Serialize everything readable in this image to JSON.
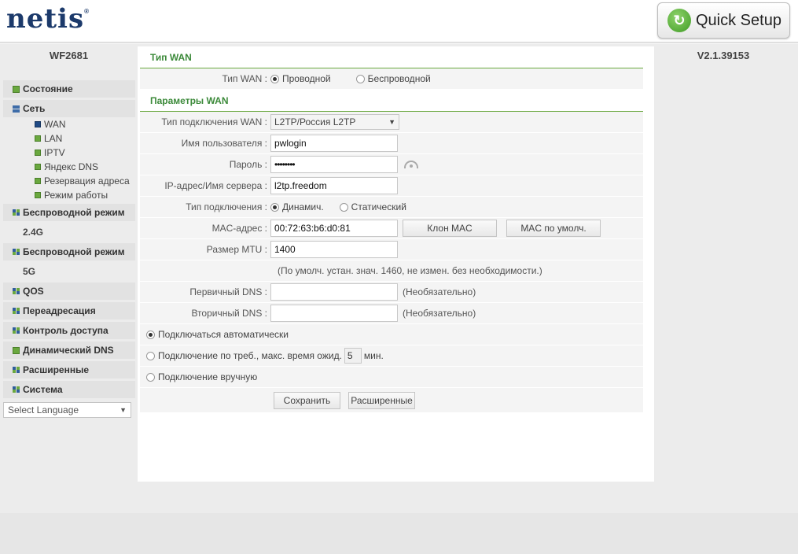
{
  "header": {
    "logo_text": "netis",
    "logo_reg": "®",
    "quick_setup_label": "Quick Setup",
    "quick_setup_icon": "refresh-arrow-icon"
  },
  "model": "WF2681",
  "version": "V2.1.39153",
  "sidebar": {
    "status": "Состояние",
    "network": "Сеть",
    "network_items": [
      "WAN",
      "LAN",
      "IPTV",
      "Яндекс DNS",
      "Резервация адреса",
      "Режим работы"
    ],
    "wireless_1": "Беспроводной режим",
    "band_1": "2.4G",
    "wireless_2": "Беспроводной режим",
    "band_2": "5G",
    "qos": "QOS",
    "forwarding": "Переадресация",
    "access_control": "Контроль доступа",
    "ddns": "Динамический DNS",
    "advanced": "Расширенные",
    "system": "Система"
  },
  "language": {
    "placeholder": "Select Language",
    "arrow": "▼"
  },
  "wan_type": {
    "title": "Тип WAN",
    "label": "Тип WAN :",
    "option_wired": "Проводной",
    "option_wireless": "Беспроводной",
    "selected": "Проводной"
  },
  "wan_params": {
    "title": "Параметры WAN",
    "conn_type_label": "Тип подключения WAN :",
    "conn_type_value": "L2TP/Россия L2TP",
    "conn_type_arrow": "▼",
    "username_label": "Имя пользователя :",
    "username_value": "pwlogin",
    "password_label": "Пароль :",
    "password_value": "••••••••",
    "server_label": "IP-адрес/Имя сервера :",
    "server_value": "l2tp.freedom",
    "ip_mode_label": "Тип подключения :",
    "ip_mode_dynamic": "Динамич.",
    "ip_mode_static": "Статический",
    "ip_mode_selected": "Динамич.",
    "mac_label": "MAC-адрес :",
    "mac_value": "00:72:63:b6:d0:81",
    "clone_mac_label": "Клон MAC",
    "default_mac_label": "MAC по умолч.",
    "mtu_label": "Размер MTU :",
    "mtu_value": "1400",
    "mtu_note": "(По умолч. устан. знач. 1460, не измен. без необходимости.)",
    "dns1_label": "Первичный DNS :",
    "dns1_value": "",
    "dns1_note": "(Необязательно)",
    "dns2_label": "Вторичный DNS :",
    "dns2_value": "",
    "dns2_note": "(Необязательно)"
  },
  "connect_mode": {
    "auto": "Подключаться автоматически",
    "on_demand_prefix": "Подключение по треб., макс. время ожид.",
    "on_demand_value": "5",
    "on_demand_suffix": "мин.",
    "manual": "Подключение вручную",
    "selected": "auto"
  },
  "actions": {
    "save": "Сохранить",
    "advanced": "Расширенные"
  }
}
